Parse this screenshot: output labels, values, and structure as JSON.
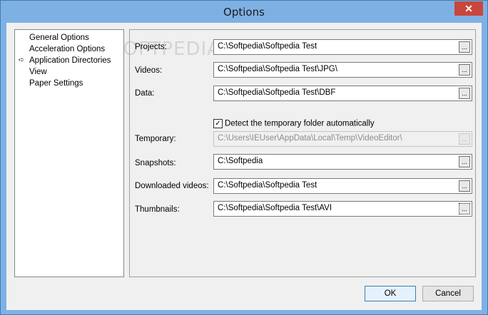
{
  "window": {
    "title": "Options",
    "close_glyph": "✕"
  },
  "tree": {
    "items": [
      {
        "label": "General Options"
      },
      {
        "label": "Acceleration Options"
      },
      {
        "label": "Application Directories",
        "selected": true
      },
      {
        "label": "View"
      },
      {
        "label": "Paper Settings"
      }
    ]
  },
  "directories": {
    "projects": {
      "label": "Projects:",
      "value": "C:\\Softpedia\\Softpedia Test"
    },
    "videos": {
      "label": "Videos:",
      "value": "C:\\Softpedia\\Softpedia Test\\JPG\\"
    },
    "data": {
      "label": "Data:",
      "value": "C:\\Softpedia\\Softpedia Test\\DBF"
    },
    "detect_temp": {
      "label": "Detect the temporary folder automatically",
      "checked": true
    },
    "temporary": {
      "label": "Temporary:",
      "value": "C:\\Users\\IEUser\\AppData\\Local\\Temp\\VideoEditor\\"
    },
    "snapshots": {
      "label": "Snapshots:",
      "value": "C:\\Softpedia"
    },
    "downloaded": {
      "label": "Downloaded videos:",
      "value": "C:\\Softpedia\\Softpedia Test"
    },
    "thumbnails": {
      "label": "Thumbnails:",
      "value": "C:\\Softpedia\\Softpedia Test\\AVI"
    },
    "browse_label": "..."
  },
  "buttons": {
    "ok": "OK",
    "cancel": "Cancel"
  },
  "watermark": "SOFTPEDIA",
  "colors": {
    "titlebar": "#7fb0e4",
    "close": "#c9463d",
    "client": "#f0f0f0"
  }
}
